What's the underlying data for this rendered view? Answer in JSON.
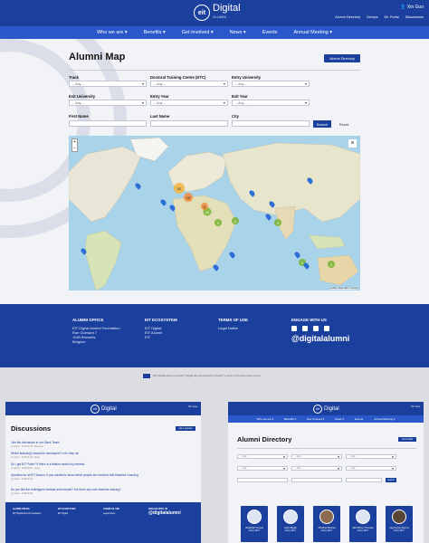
{
  "brand": {
    "name": "Digital",
    "sub": "ALUMNI",
    "mark": "eit"
  },
  "topbar": {
    "user": "Xin Guo",
    "links": [
      "Alumni Directory",
      "Groups",
      "Mr. Portal",
      "Discussions"
    ]
  },
  "nav": [
    "Who we are ▾",
    "Benefits ▾",
    "Get involved ▾",
    "News ▾",
    "Events",
    "Annual Meeting ▾"
  ],
  "page": {
    "title": "Alumni Map",
    "directory_button": "Alumni Directory",
    "filters": {
      "track": {
        "label": "Track",
        "value": "-- Any --"
      },
      "dtc": {
        "label": "Doctoral Training Centre (DTC)",
        "value": "-- Any --"
      },
      "entry_university": {
        "label": "Entry University",
        "value": "-- Any --"
      },
      "exit_university": {
        "label": "Exit University",
        "value": "-- Any --"
      },
      "entry_year": {
        "label": "Entry Year",
        "value": "-- Any --"
      },
      "exit_year": {
        "label": "Exit Year",
        "value": "-- Any --"
      },
      "first_name": {
        "label": "First Name"
      },
      "last_name": {
        "label": "Last Name"
      },
      "city": {
        "label": "City"
      }
    },
    "search_button": "Search",
    "reset_button": "Reset",
    "map": {
      "zoom_in": "+",
      "zoom_out": "−",
      "attribution": "Leaflet | Map data © Google",
      "layers_icon": "layers-icon"
    }
  },
  "footer": {
    "office": {
      "title": "ALUMNI OFFICE",
      "lines": [
        "EIT Digital Alumni Foundation",
        "Rue Guimard 7",
        "1040 Brussels",
        "Belgium"
      ]
    },
    "ecosystem": {
      "title": "EIT ECOSYSTEM",
      "links": [
        "EIT Digital",
        "EIT Alumni",
        "EIT"
      ]
    },
    "terms": {
      "title": "TERMS OF USE",
      "links": [
        "Legal Notice"
      ]
    },
    "engage": {
      "title": "ENGAGE WITH US",
      "handle": "@digitalalumni"
    }
  },
  "eu_note": "EIT Digital Alumni and EIT Digital are supported by the EIT, a body of the European Union",
  "discussions": {
    "title": "Discussions",
    "button": "Ask a question",
    "items": [
      {
        "title": "Join the discussion in our Slack Team!",
        "meta": "by admin · 2019-01-09 · Business"
      },
      {
        "title": "Which feature(s) should be developed? Let's help us!",
        "meta": "by admin · 2018-11-09 · Ideas"
      },
      {
        "title": "Do I get EIT Pulse? If there is a feature search by interest.",
        "meta": "by admin · 2018-08-02 · Ideas"
      },
      {
        "title": "Question for all EIT Alumni: If you wanted to know which people are involved with Machine Learning.",
        "meta": "by admin · 2018-06-12"
      },
      {
        "title": "Do you like the redesigned website and intranet? Are there any core features missing?",
        "meta": "by admin · 2018-05-09"
      }
    ]
  },
  "directory": {
    "title": "Alumni Directory",
    "map_button": "Alumni Map",
    "people": [
      {
        "name": "Abdelhadi Youssef",
        "line": "Entry 2015"
      },
      {
        "name": "Adam Bergin",
        "line": "Entry 2014"
      },
      {
        "name": "Abhishek Sharma",
        "line": "Entry 2016"
      },
      {
        "name": "Albin Birmer Troncoso",
        "line": "Entry 2015"
      },
      {
        "name": "Ajay Kumar Sharma",
        "line": "Entry 2017"
      }
    ]
  },
  "colors": {
    "primary": "#1a3f9c",
    "nav": "#2a57c9",
    "marker": "#2b6fd6",
    "cluster": "#78b431"
  }
}
